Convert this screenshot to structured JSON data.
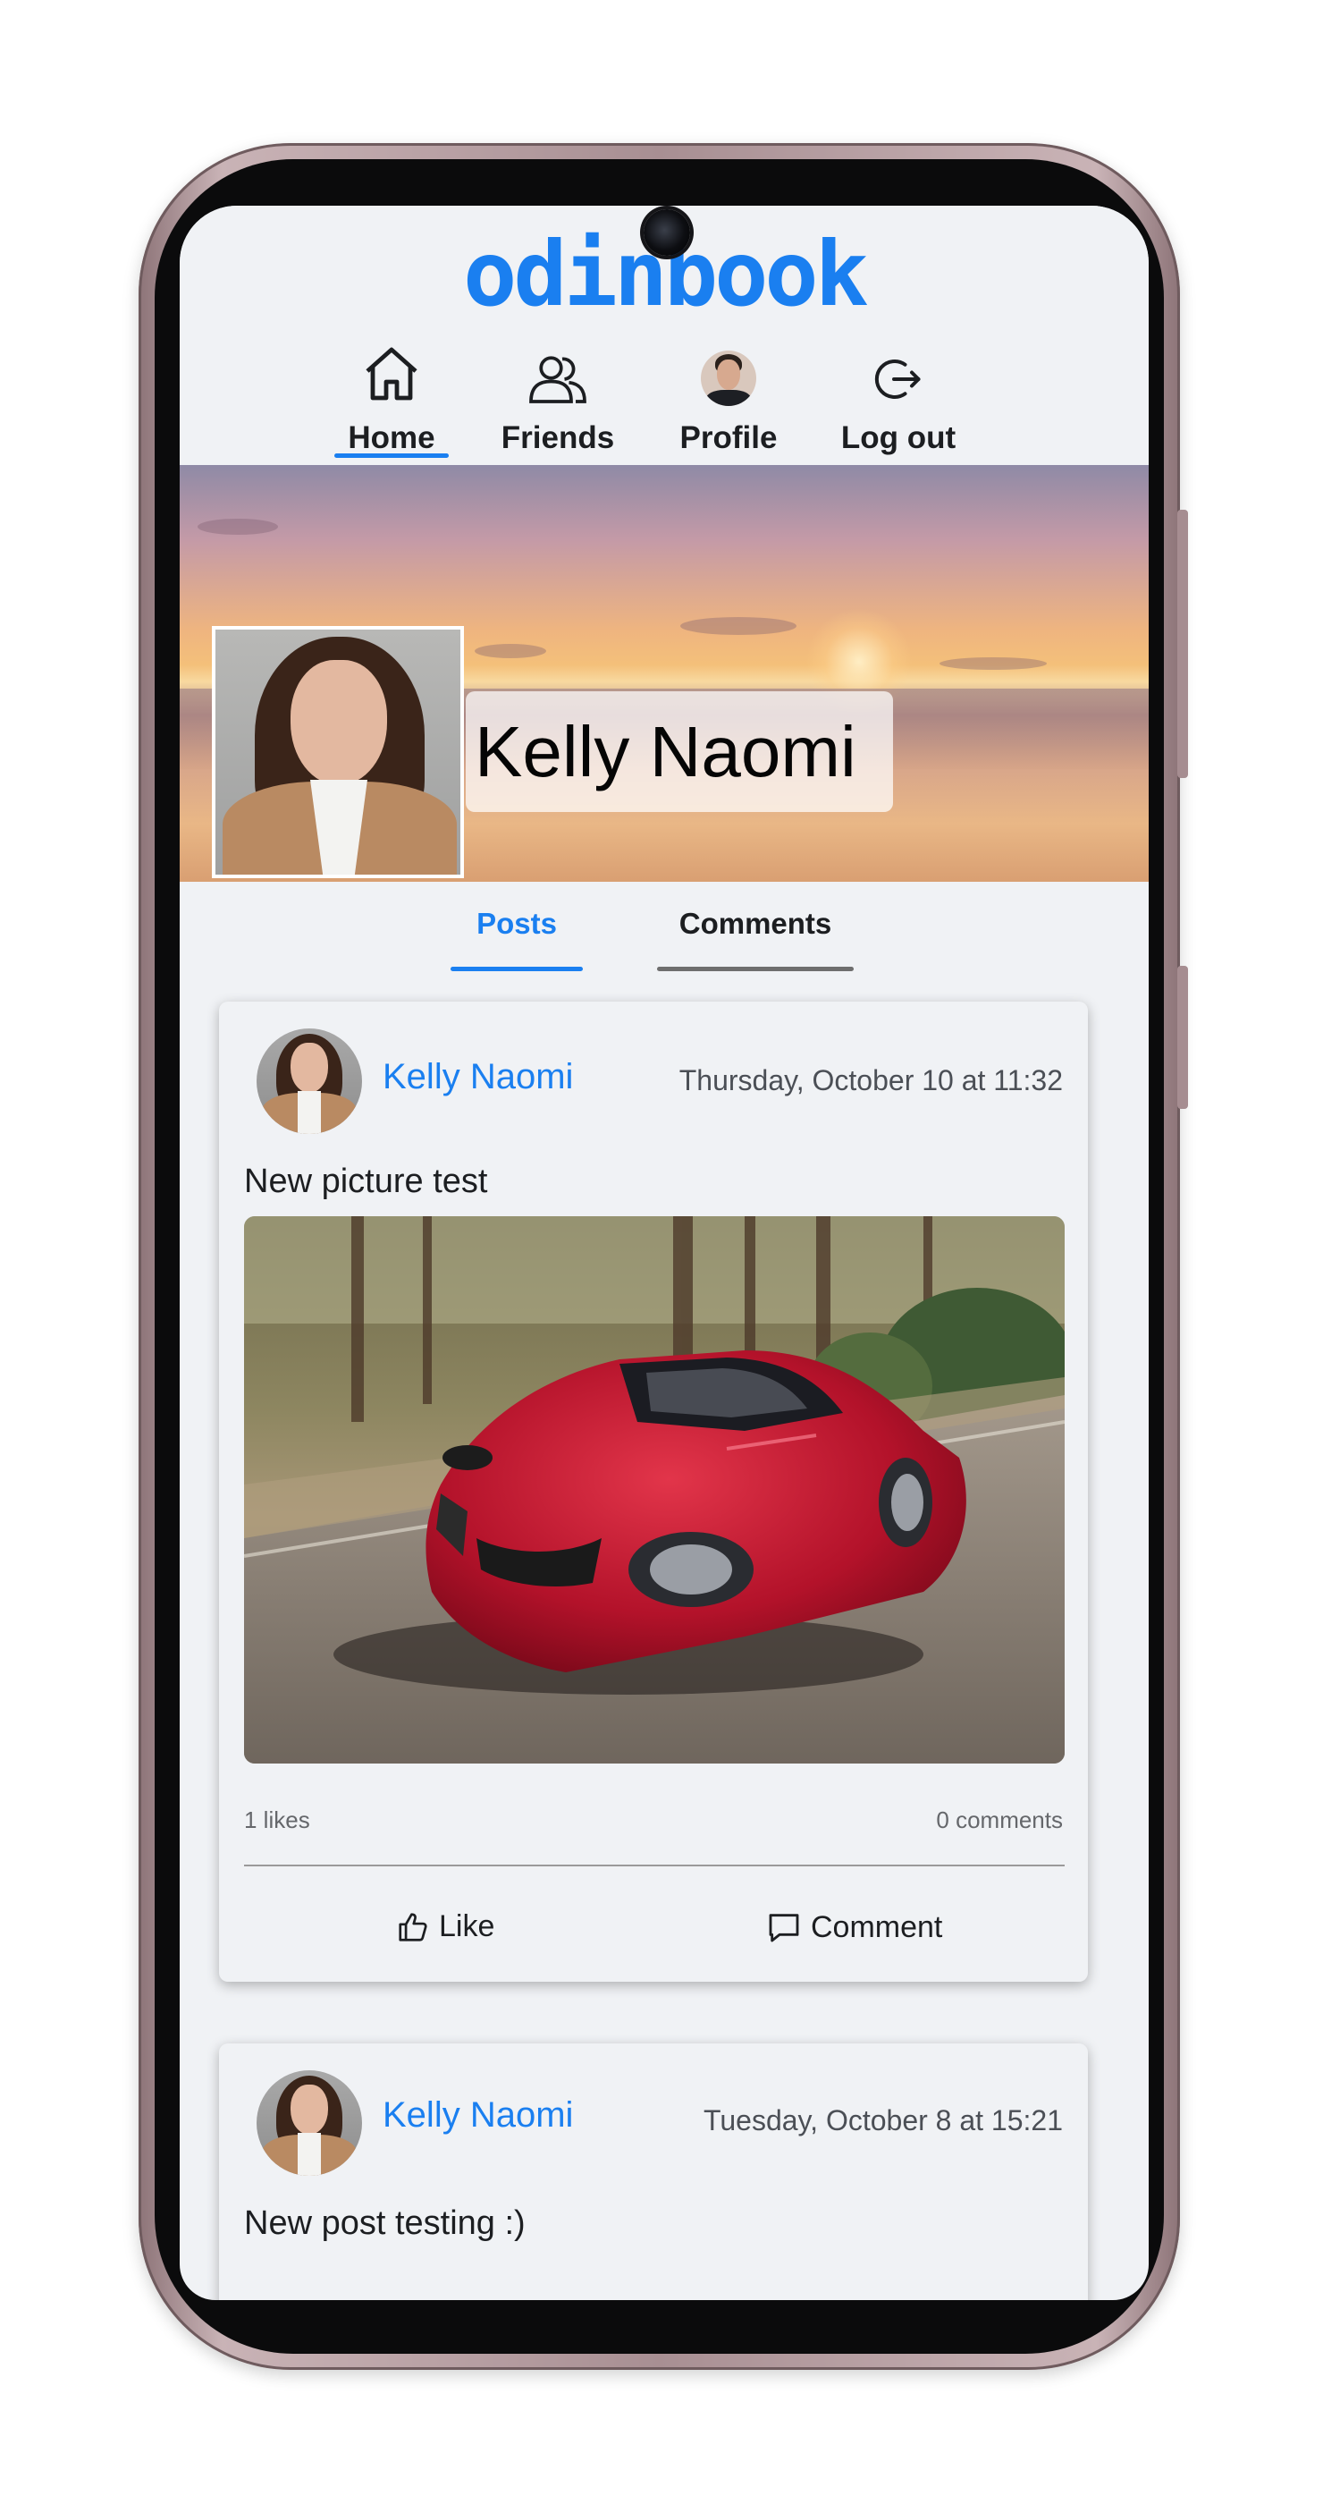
{
  "app": {
    "logo": "odinbook"
  },
  "nav": {
    "items": [
      {
        "label": "Home",
        "icon": "home-icon",
        "active": true
      },
      {
        "label": "Friends",
        "icon": "friends-icon",
        "active": false
      },
      {
        "label": "Profile",
        "icon": "avatar",
        "active": false
      },
      {
        "label": "Log out",
        "icon": "logout-icon",
        "active": false
      }
    ]
  },
  "profile": {
    "name": "Kelly Naomi"
  },
  "tabs": [
    {
      "label": "Posts",
      "active": true
    },
    {
      "label": "Comments",
      "active": false
    }
  ],
  "posts": [
    {
      "author": "Kelly Naomi",
      "date": "Thursday, October 10 at 11:32",
      "text": "New picture test",
      "likes": "1 likes",
      "comments": "0 comments",
      "like_label": "Like",
      "comment_label": "Comment"
    },
    {
      "author": "Kelly Naomi",
      "date": "Tuesday, October 8 at 15:21",
      "text": "New post testing :)"
    }
  ],
  "colors": {
    "accent": "#1a7ff0",
    "background": "#f0f2f5",
    "text": "#1c1e21",
    "inactive_tab_bar": "#6e6e6e"
  }
}
